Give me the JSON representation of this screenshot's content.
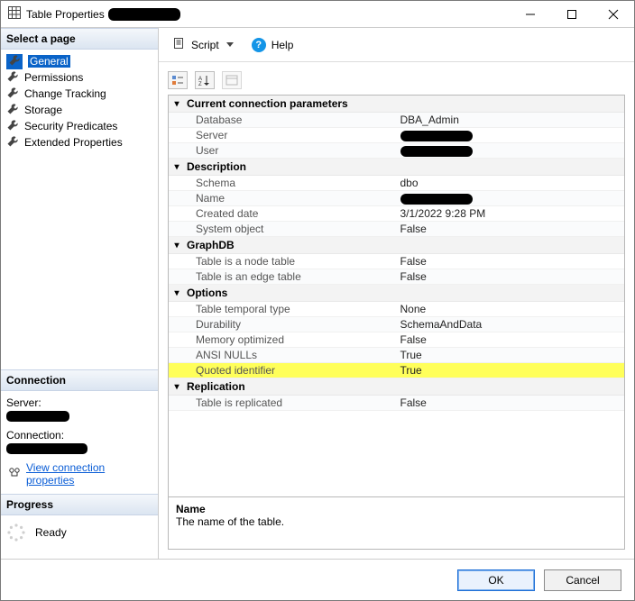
{
  "titlebar": {
    "title": "Table Properties"
  },
  "left": {
    "select_page": "Select a page",
    "pages": [
      {
        "label": "General",
        "selected": true
      },
      {
        "label": "Permissions"
      },
      {
        "label": "Change Tracking"
      },
      {
        "label": "Storage"
      },
      {
        "label": "Security Predicates"
      },
      {
        "label": "Extended Properties"
      }
    ],
    "connection": {
      "heading": "Connection",
      "server_label": "Server:",
      "connection_label": "Connection:",
      "link": "View connection properties"
    },
    "progress": {
      "heading": "Progress",
      "status": "Ready"
    }
  },
  "toolbar": {
    "script": "Script",
    "help": "Help"
  },
  "grid": {
    "categories": [
      {
        "name": "Current connection parameters",
        "rows": [
          {
            "key": "Database",
            "value": "DBA_Admin"
          },
          {
            "key": "Server",
            "redacted": true
          },
          {
            "key": "User",
            "redacted": true
          }
        ]
      },
      {
        "name": "Description",
        "rows": [
          {
            "key": "Schema",
            "value": "dbo"
          },
          {
            "key": "Name",
            "redacted": true
          },
          {
            "key": "Created date",
            "value": "3/1/2022 9:28 PM"
          },
          {
            "key": "System object",
            "value": "False"
          }
        ]
      },
      {
        "name": "GraphDB",
        "rows": [
          {
            "key": "Table is a node table",
            "value": "False"
          },
          {
            "key": "Table is an edge table",
            "value": "False"
          }
        ]
      },
      {
        "name": "Options",
        "rows": [
          {
            "key": "Table temporal type",
            "value": "None"
          },
          {
            "key": "Durability",
            "value": "SchemaAndData"
          },
          {
            "key": "Memory optimized",
            "value": "False"
          },
          {
            "key": "ANSI NULLs",
            "value": "True"
          },
          {
            "key": "Quoted identifier",
            "value": "True",
            "highlight": true
          }
        ]
      },
      {
        "name": "Replication",
        "rows": [
          {
            "key": "Table is replicated",
            "value": "False"
          }
        ]
      }
    ]
  },
  "description_pane": {
    "name": "Name",
    "text": "The name of the table."
  },
  "footer": {
    "ok": "OK",
    "cancel": "Cancel"
  }
}
